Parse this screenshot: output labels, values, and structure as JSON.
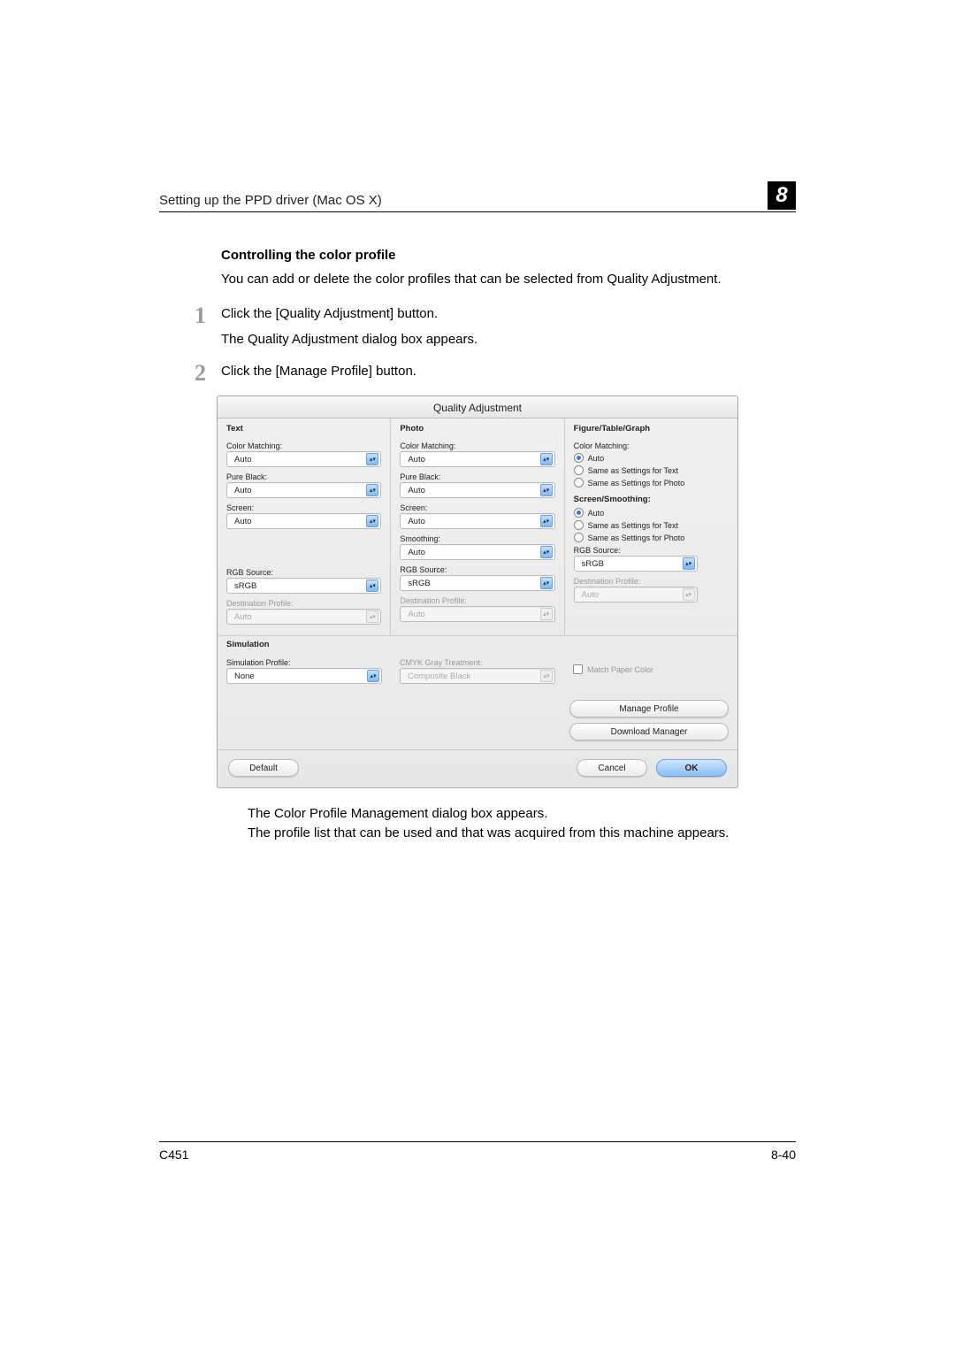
{
  "header": {
    "left": "Setting up the PPD driver (Mac OS X)",
    "chapter": "8"
  },
  "section_title": "Controlling the color profile",
  "intro": "You can add or delete the color profiles that can be selected from Quality Adjustment.",
  "steps": {
    "1": {
      "num": "1",
      "line1": "Click the [Quality Adjustment] button.",
      "line2": "The Quality Adjustment dialog box appears."
    },
    "2": {
      "num": "2",
      "line1": "Click the [Manage Profile] button."
    }
  },
  "dialog": {
    "title": "Quality Adjustment",
    "cols": {
      "text": {
        "tab": "Text",
        "color_matching": {
          "label": "Color Matching:",
          "value": "Auto"
        },
        "pure_black": {
          "label": "Pure Black:",
          "value": "Auto"
        },
        "screen": {
          "label": "Screen:",
          "value": "Auto"
        },
        "rgb_source": {
          "label": "RGB Source:",
          "value": "sRGB"
        },
        "dest_profile": {
          "label": "Destination Profile:",
          "value": "Auto"
        }
      },
      "photo": {
        "tab": "Photo",
        "color_matching": {
          "label": "Color Matching:",
          "value": "Auto"
        },
        "pure_black": {
          "label": "Pure Black:",
          "value": "Auto"
        },
        "screen": {
          "label": "Screen:",
          "value": "Auto"
        },
        "smoothing": {
          "label": "Smoothing:",
          "value": "Auto"
        },
        "rgb_source": {
          "label": "RGB Source:",
          "value": "sRGB"
        },
        "dest_profile": {
          "label": "Destination Profile:",
          "value": "Auto"
        }
      },
      "ftg": {
        "tab": "Figure/Table/Graph",
        "color_matching_label": "Color Matching:",
        "cm_auto": "Auto",
        "cm_same_text": "Same as Settings for Text",
        "cm_same_photo": "Same as Settings for Photo",
        "ss_label": "Screen/Smoothing:",
        "ss_auto": "Auto",
        "ss_same_text": "Same as Settings for Text",
        "ss_same_photo": "Same as Settings for Photo",
        "rgb_source": {
          "label": "RGB Source:",
          "value": "sRGB"
        },
        "dest_profile": {
          "label": "Destination Profile:",
          "value": "Auto"
        }
      }
    },
    "simulation": {
      "header": "Simulation",
      "profile": {
        "label": "Simulation Profile:",
        "value": "None"
      },
      "cmyk": {
        "label": "CMYK Gray Treatment:",
        "value": "Composite Black"
      },
      "match_paper": "Match Paper Color"
    },
    "buttons": {
      "manage_profile": "Manage Profile",
      "download_manager": "Download Manager",
      "default": "Default",
      "cancel": "Cancel",
      "ok": "OK"
    }
  },
  "after": {
    "line1": "The Color Profile Management dialog box appears.",
    "line2": "The profile list that can be used and that was acquired from this machine appears."
  },
  "footer": {
    "left": "C451",
    "right": "8-40"
  }
}
